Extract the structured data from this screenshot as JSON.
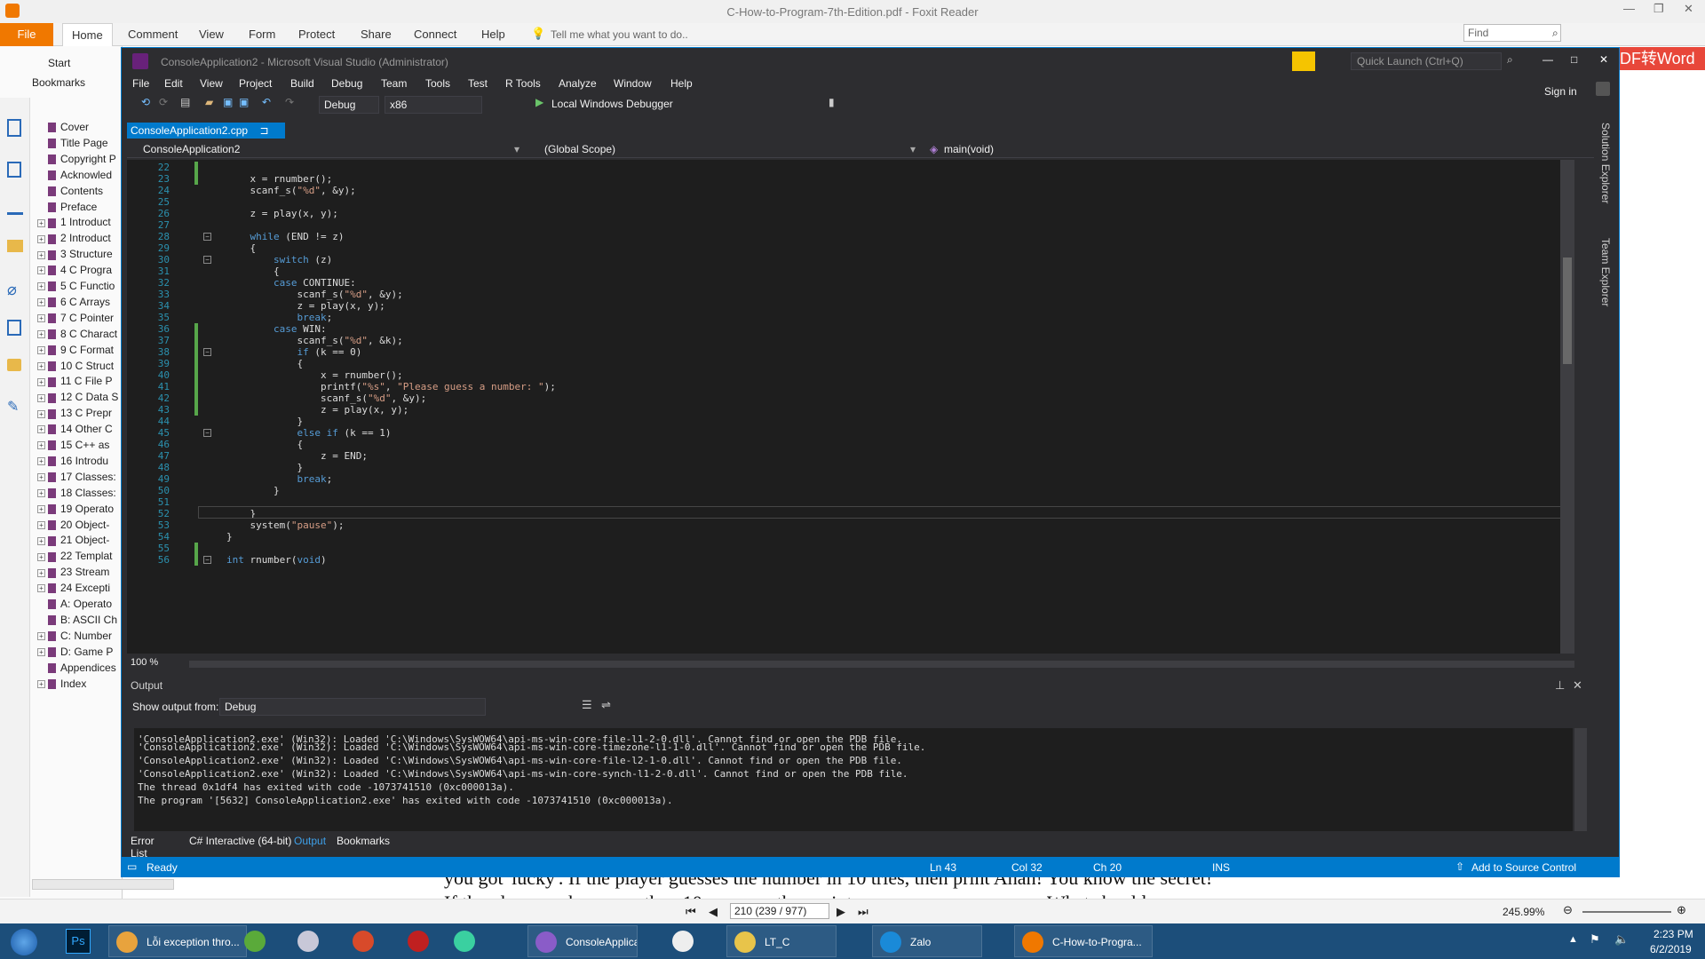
{
  "foxit": {
    "title": "C-How-to-Program-7th-Edition.pdf - Foxit Reader",
    "tabs": [
      "File",
      "Home",
      "Comment",
      "View",
      "Form",
      "Protect",
      "Share",
      "Connect",
      "Help"
    ],
    "tell_me": "Tell me what you want to do..",
    "find_placeholder": "Find",
    "start_label": "Start",
    "bookmarks_label": "Bookmarks",
    "pdf_to_word": "DF转Word",
    "bookmarks": [
      {
        "label": "Cover",
        "exp": false
      },
      {
        "label": "Title Page",
        "exp": false
      },
      {
        "label": "Copyright P",
        "exp": false
      },
      {
        "label": "Acknowled",
        "exp": false
      },
      {
        "label": "Contents",
        "exp": false
      },
      {
        "label": "Preface",
        "exp": false
      },
      {
        "label": "1 Introduct",
        "exp": true
      },
      {
        "label": "2 Introduct",
        "exp": true
      },
      {
        "label": "3 Structure",
        "exp": true
      },
      {
        "label": "4 C Progra",
        "exp": true
      },
      {
        "label": "5 C Functio",
        "exp": true
      },
      {
        "label": "6 C Arrays",
        "exp": true
      },
      {
        "label": "7 C Pointer",
        "exp": true
      },
      {
        "label": "8 C Charact",
        "exp": true
      },
      {
        "label": "9 C Format",
        "exp": true
      },
      {
        "label": "10 C Struct",
        "exp": true
      },
      {
        "label": "11 C File P",
        "exp": true
      },
      {
        "label": "12 C Data S",
        "exp": true
      },
      {
        "label": "13 C Prepr",
        "exp": true
      },
      {
        "label": "14 Other C",
        "exp": true
      },
      {
        "label": "15 C++ as",
        "exp": true
      },
      {
        "label": "16 Introdu",
        "exp": true
      },
      {
        "label": "17 Classes:",
        "exp": true
      },
      {
        "label": "18 Classes:",
        "exp": true
      },
      {
        "label": "19 Operato",
        "exp": true
      },
      {
        "label": "20 Object-",
        "exp": true
      },
      {
        "label": "21 Object-",
        "exp": true
      },
      {
        "label": "22 Templat",
        "exp": true
      },
      {
        "label": "23 Stream",
        "exp": true
      },
      {
        "label": "24 Excepti",
        "exp": true
      },
      {
        "label": "A: Operato",
        "exp": false
      },
      {
        "label": "B: ASCII Ch",
        "exp": false
      },
      {
        "label": "C: Number",
        "exp": true
      },
      {
        "label": "D: Game P",
        "exp": true
      },
      {
        "label": "Appendices",
        "exp": false
      },
      {
        "label": "Index",
        "exp": true
      }
    ],
    "page_box": "210 (239 / 977)",
    "zoom": "245.99%",
    "pdf_text_line1": "you got 'lucky'. If the player guesses the number in 10 tries, then print Ahah! You know the secret!",
    "pdf_text_line2": "If the player makes more than 10 guesses, then print                                        What should"
  },
  "vs": {
    "title": "ConsoleApplication2 - Microsoft Visual Studio (Administrator)",
    "quick_launch": "Quick Launch (Ctrl+Q)",
    "sign_in": "Sign in",
    "menu": [
      "File",
      "Edit",
      "View",
      "Project",
      "Build",
      "Debug",
      "Team",
      "Tools",
      "Test",
      "R Tools",
      "Analyze",
      "Window",
      "Help"
    ],
    "config": "Debug",
    "platform": "x86",
    "debugger": "Local Windows Debugger",
    "doc_tab": "ConsoleApplication2.cpp",
    "nav_project": "ConsoleApplication2",
    "nav_scope": "(Global Scope)",
    "nav_func": "main(void)",
    "zoom": "100 %",
    "code_lines": [
      {
        "n": "22",
        "t": ""
      },
      {
        "n": "23",
        "t": "    x = rnumber();"
      },
      {
        "n": "24",
        "t": "    scanf_s(\"%d\", &y);"
      },
      {
        "n": "25",
        "t": ""
      },
      {
        "n": "26",
        "t": "    z = play(x, y);"
      },
      {
        "n": "27",
        "t": ""
      },
      {
        "n": "28",
        "t": "    while (END != z)"
      },
      {
        "n": "29",
        "t": "    {"
      },
      {
        "n": "30",
        "t": "        switch (z)"
      },
      {
        "n": "31",
        "t": "        {"
      },
      {
        "n": "32",
        "t": "        case CONTINUE:"
      },
      {
        "n": "33",
        "t": "            scanf_s(\"%d\", &y);"
      },
      {
        "n": "34",
        "t": "            z = play(x, y);"
      },
      {
        "n": "35",
        "t": "            break;"
      },
      {
        "n": "36",
        "t": "        case WIN:"
      },
      {
        "n": "37",
        "t": "            scanf_s(\"%d\", &k);"
      },
      {
        "n": "38",
        "t": "            if (k == 0)"
      },
      {
        "n": "39",
        "t": "            {"
      },
      {
        "n": "40",
        "t": "                x = rnumber();"
      },
      {
        "n": "41",
        "t": "                printf(\"%s\", \"Please guess a number: \");"
      },
      {
        "n": "42",
        "t": "                scanf_s(\"%d\", &y);"
      },
      {
        "n": "43",
        "t": "                z = play(x, y);"
      },
      {
        "n": "44",
        "t": "            }"
      },
      {
        "n": "45",
        "t": "            else if (k == 1)"
      },
      {
        "n": "46",
        "t": "            {"
      },
      {
        "n": "47",
        "t": "                z = END;"
      },
      {
        "n": "48",
        "t": "            }"
      },
      {
        "n": "49",
        "t": "            break;"
      },
      {
        "n": "50",
        "t": "        }"
      },
      {
        "n": "51",
        "t": ""
      },
      {
        "n": "52",
        "t": "    }"
      },
      {
        "n": "53",
        "t": "    system(\"pause\");"
      },
      {
        "n": "54",
        "t": "}"
      },
      {
        "n": "55",
        "t": ""
      },
      {
        "n": "56",
        "t": "int rnumber(void)"
      }
    ],
    "output": {
      "title": "Output",
      "show_from_label": "Show output from:",
      "source": "Debug",
      "lines": [
        "'ConsoleApplication2.exe' (Win32): Loaded 'C:\\Windows\\SysWOW64\\api-ms-win-core-file-l1-2-0.dll'. Cannot find or open the PDB file.",
        "'ConsoleApplication2.exe' (Win32): Loaded 'C:\\Windows\\SysWOW64\\api-ms-win-core-timezone-l1-1-0.dll'. Cannot find or open the PDB file.",
        "'ConsoleApplication2.exe' (Win32): Loaded 'C:\\Windows\\SysWOW64\\api-ms-win-core-file-l2-1-0.dll'. Cannot find or open the PDB file.",
        "'ConsoleApplication2.exe' (Win32): Loaded 'C:\\Windows\\SysWOW64\\api-ms-win-core-synch-l1-2-0.dll'. Cannot find or open the PDB file.",
        "The thread 0x1df4 has exited with code -1073741510 (0xc000013a).",
        "The program '[5632] ConsoleApplication2.exe' has exited with code -1073741510 (0xc000013a)."
      ]
    },
    "bottom_tabs": [
      "Error List",
      "C# Interactive (64-bit)",
      "Output",
      "Bookmarks"
    ],
    "status": {
      "ready": "Ready",
      "ln": "Ln 43",
      "col": "Col 32",
      "ch": "Ch 20",
      "ins": "INS",
      "source_control": "Add to Source Control"
    },
    "side_tabs": [
      "Solution Explorer",
      "Team Explorer"
    ]
  },
  "taskbar": {
    "items": [
      {
        "label": "Lỗi exception thro...",
        "color": "#e8a33d"
      },
      {
        "label": "",
        "color": "#5aaa3a"
      },
      {
        "label": "",
        "color": "#c8c8d8"
      },
      {
        "label": "",
        "color": "#d84a2a"
      },
      {
        "label": "",
        "color": "#c02020"
      },
      {
        "label": "",
        "color": "#3ad0a0"
      },
      {
        "label": "ConsoleApplicati...",
        "color": "#8a5cc8"
      },
      {
        "label": "",
        "color": "#eeeeee"
      },
      {
        "label": "LT_C",
        "color": "#e8c44a"
      },
      {
        "label": "Zalo",
        "color": "#1a8ad8"
      },
      {
        "label": "C-How-to-Progra...",
        "color": "#f07800"
      }
    ],
    "time": "2:23 PM",
    "date": "6/2/2019"
  }
}
